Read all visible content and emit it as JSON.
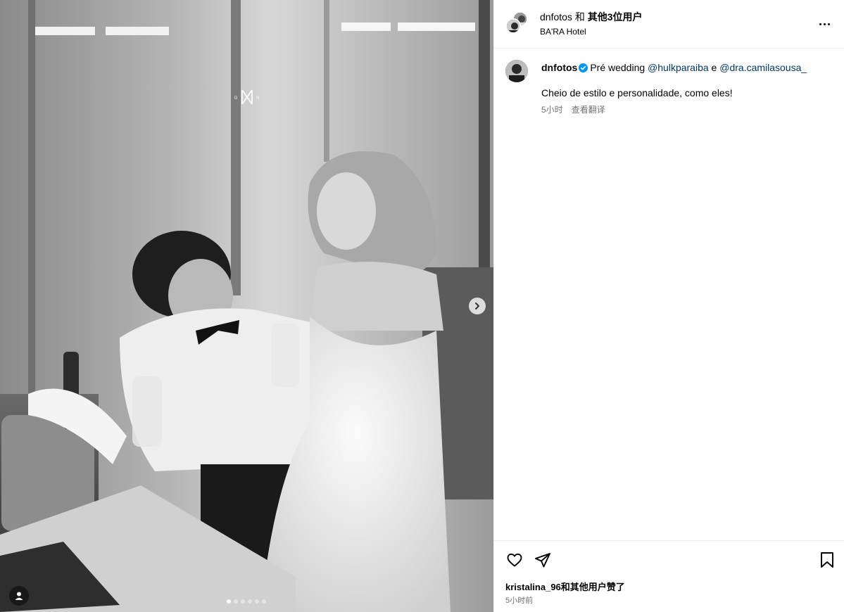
{
  "header": {
    "username": "dnfotos",
    "and_text": " 和 ",
    "others_text": "其他3位用户",
    "location": "BA'RA Hotel"
  },
  "media": {
    "watermark_text": "D N",
    "slides_total": 6,
    "slide_active": 1
  },
  "caption": {
    "username": "dnfotos",
    "lead": "Pré wedding ",
    "mention1": "@hulkparaiba",
    "joiner": " e ",
    "mention2": "@dra.camilasousa_",
    "line2": "Cheio de estilo e personalidade, como eles!",
    "time": "5小时",
    "translate_label": "查看翻译"
  },
  "footer": {
    "likes_text": "kristalina_96和其他用户赞了",
    "time": "5小时前"
  },
  "icons": {
    "like": "heart-icon",
    "share": "paper-plane-icon",
    "save": "bookmark-icon",
    "more": "more-horizontal-icon",
    "next": "chevron-right-icon",
    "tags": "user-icon",
    "verified": "verified-badge-icon"
  },
  "colors": {
    "link": "#00376b",
    "secondary_text": "#737373",
    "verified": "#0095f6",
    "divider": "#efefef"
  }
}
